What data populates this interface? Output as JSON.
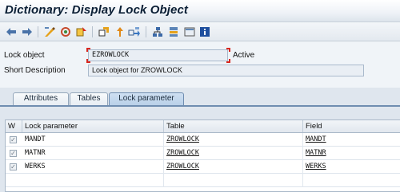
{
  "window": {
    "title": "Dictionary: Display Lock Object"
  },
  "toolbar": {
    "buttons": [
      {
        "name": "back-icon"
      },
      {
        "name": "forward-icon"
      },
      {
        "name": "display-change-icon"
      },
      {
        "name": "other-object-icon"
      },
      {
        "name": "activate-icon"
      },
      {
        "name": "where-used-icon"
      },
      {
        "name": "up-arrow-icon"
      },
      {
        "name": "navigate-icon"
      },
      {
        "name": "hierarchy-icon"
      },
      {
        "name": "structure-icon"
      },
      {
        "name": "layout-icon"
      },
      {
        "name": "info-icon"
      }
    ]
  },
  "form": {
    "lock_object_label": "Lock object",
    "lock_object_value": "EZROWLOCK",
    "status": "Active",
    "short_desc_label": "Short Description",
    "short_desc_value": "Lock object for ZROWLOCK"
  },
  "tabs": [
    {
      "label": "Attributes",
      "active": false
    },
    {
      "label": "Tables",
      "active": false
    },
    {
      "label": "Lock parameter",
      "active": true
    }
  ],
  "grid": {
    "columns": [
      "W",
      "Lock parameter",
      "Table",
      "Field"
    ],
    "rows": [
      {
        "checked": true,
        "param": "MANDT",
        "table": "ZROWLOCK",
        "field": "MANDT"
      },
      {
        "checked": true,
        "param": "MATNR",
        "table": "ZROWLOCK",
        "field": "MATNR"
      },
      {
        "checked": true,
        "param": "WERKS",
        "table": "ZROWLOCK",
        "field": "WERKS"
      }
    ]
  },
  "colors": {
    "accent": "#6f8db0",
    "focus_marker": "#d9251d",
    "background": "#dfe6ee"
  }
}
